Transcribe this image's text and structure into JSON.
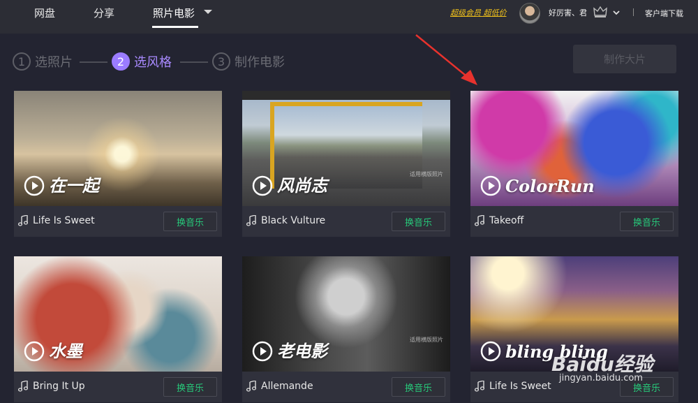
{
  "nav": {
    "items": [
      "网盘",
      "分享",
      "照片电影"
    ],
    "vip_link": "超级会员 超低价",
    "username": "好厉害、君",
    "client_download": "客户端下载"
  },
  "steps": [
    {
      "num": "1",
      "label": "选照片"
    },
    {
      "num": "2",
      "label": "选风格"
    },
    {
      "num": "3",
      "label": "制作电影"
    }
  ],
  "make_button": "制作大片",
  "cards": [
    {
      "title": "在一起",
      "song": "Life Is Sweet",
      "button": "换音乐",
      "hint": ""
    },
    {
      "title": "风尚志",
      "song": "Black Vulture",
      "button": "换音乐",
      "hint": "适用横版照片"
    },
    {
      "title": "ColorRun",
      "song": "Takeoff",
      "button": "换音乐",
      "hint": ""
    },
    {
      "title": "水墨",
      "song": "Bring It Up",
      "button": "换音乐",
      "hint": ""
    },
    {
      "title": "老电影",
      "song": "Allemande",
      "button": "换音乐",
      "hint": "适用横版照片"
    },
    {
      "title": "bling bling",
      "song": "Life Is Sweet",
      "button": "换音乐",
      "hint": ""
    }
  ],
  "watermark": {
    "brand": "Baidu经验",
    "url": "jingyan.baidu.com"
  },
  "colors": {
    "accent": "#9b7cff",
    "swap_text": "#27c97a",
    "vip": "#f2c21a",
    "arrow": "#e8322d"
  }
}
